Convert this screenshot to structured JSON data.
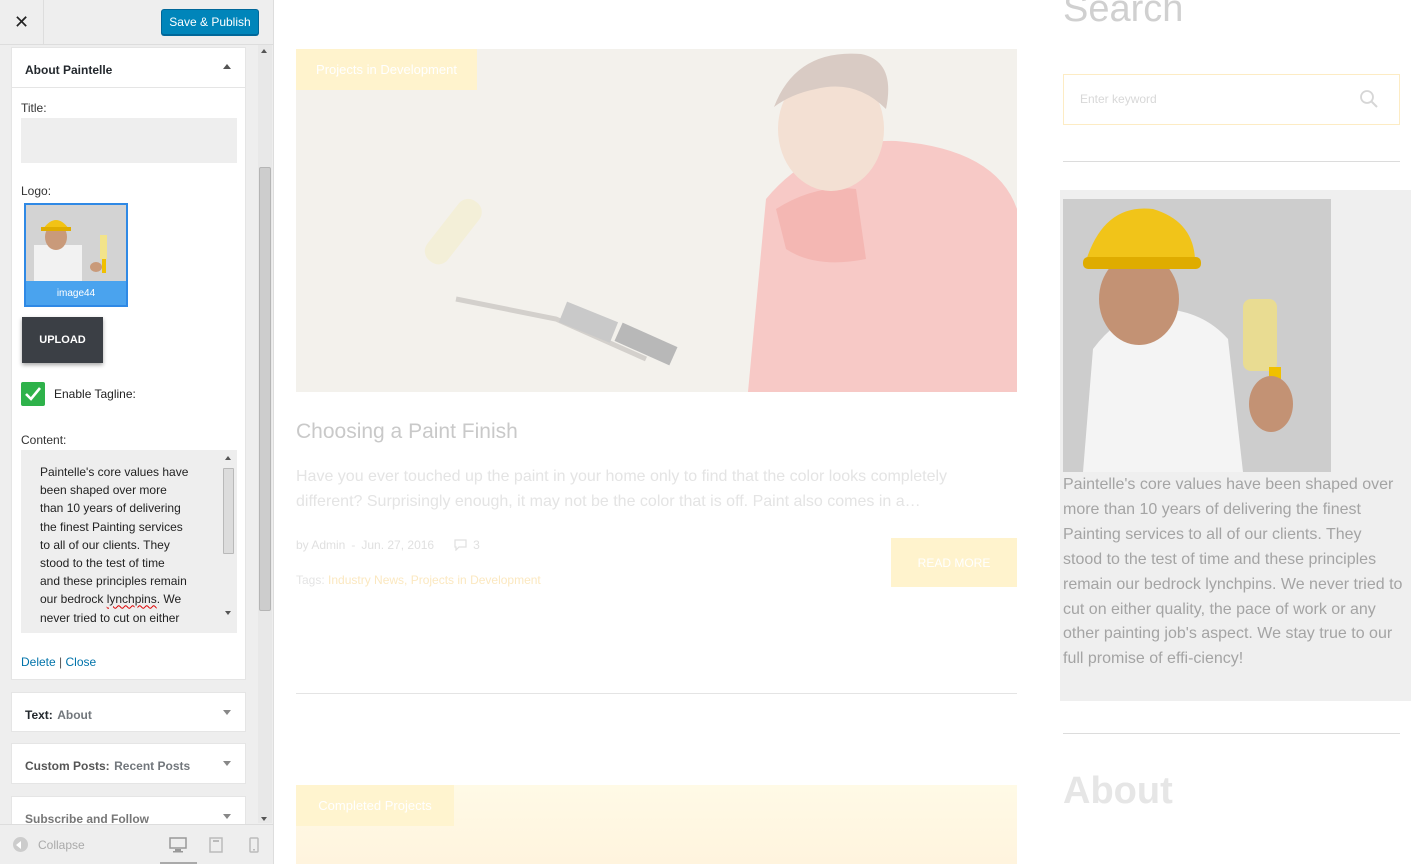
{
  "sidebar": {
    "close_label": "✕",
    "publish_label": "Save & Publish",
    "about_panel": {
      "title": "About Paintelle",
      "title_field_label": "Title:",
      "title_value": "",
      "logo_label": "Logo:",
      "logo_caption": "image44",
      "upload_label": "UPLOAD",
      "tagline_label": "Enable Tagline:",
      "tagline_checked": true,
      "content_label": "Content:",
      "content_lines": [
        "Paintelle's core values have",
        "been shaped over more",
        "than 10 years of delivering",
        "the finest  Painting services",
        "to all of our clients. They",
        "stood to the test of time",
        "and these principles remain"
      ],
      "content_line_8a": "our bedrock ",
      "content_line_8_word": "lynchpins",
      "content_line_8b": ". We",
      "content_line_9": "never tried to cut on either",
      "delete_label": "Delete",
      "separator": "|",
      "close_label": "Close"
    },
    "widgets": [
      {
        "prefix": "Text:",
        "name": "About"
      },
      {
        "prefix": "Custom Posts:",
        "name": "Recent Posts"
      },
      {
        "prefix": "Subscribe and Follow",
        "name": ""
      }
    ],
    "collapse_label": "Collapse"
  },
  "preview": {
    "post": {
      "badge": "Projects in Development",
      "title": "Choosing a Paint Finish",
      "excerpt": "Have you ever touched up the paint in your home only to find that the color looks completely different? Surprisingly enough, it may not be the color that is off. Paint also comes in a…",
      "author": "by Admin",
      "date_sep": " - ",
      "date": "Jun. 27, 2016",
      "comments": "3",
      "tags_label": "Tags: ",
      "tags": "Industry News, Projects in Development",
      "read_more": "READ MORE"
    },
    "post2": {
      "badge": "Completed Projects"
    },
    "sidebar": {
      "search_heading": "Search",
      "search_placeholder": "Enter keyword",
      "about_text": "Paintelle's core values have been shaped over more than 10 years of delivering the finest Painting services to all of our clients. They stood to the test of time and these principles remain our bedrock lynchpins. We never tried to cut on either quality, the pace of work or any other painting job's aspect. We stay true to our full promise of effi-ciency!",
      "about_heading": "About"
    }
  },
  "colors": {
    "publish_blue": "#0085ba",
    "check_green": "#2eb24a",
    "accent_yellow": "#fff3cd"
  }
}
